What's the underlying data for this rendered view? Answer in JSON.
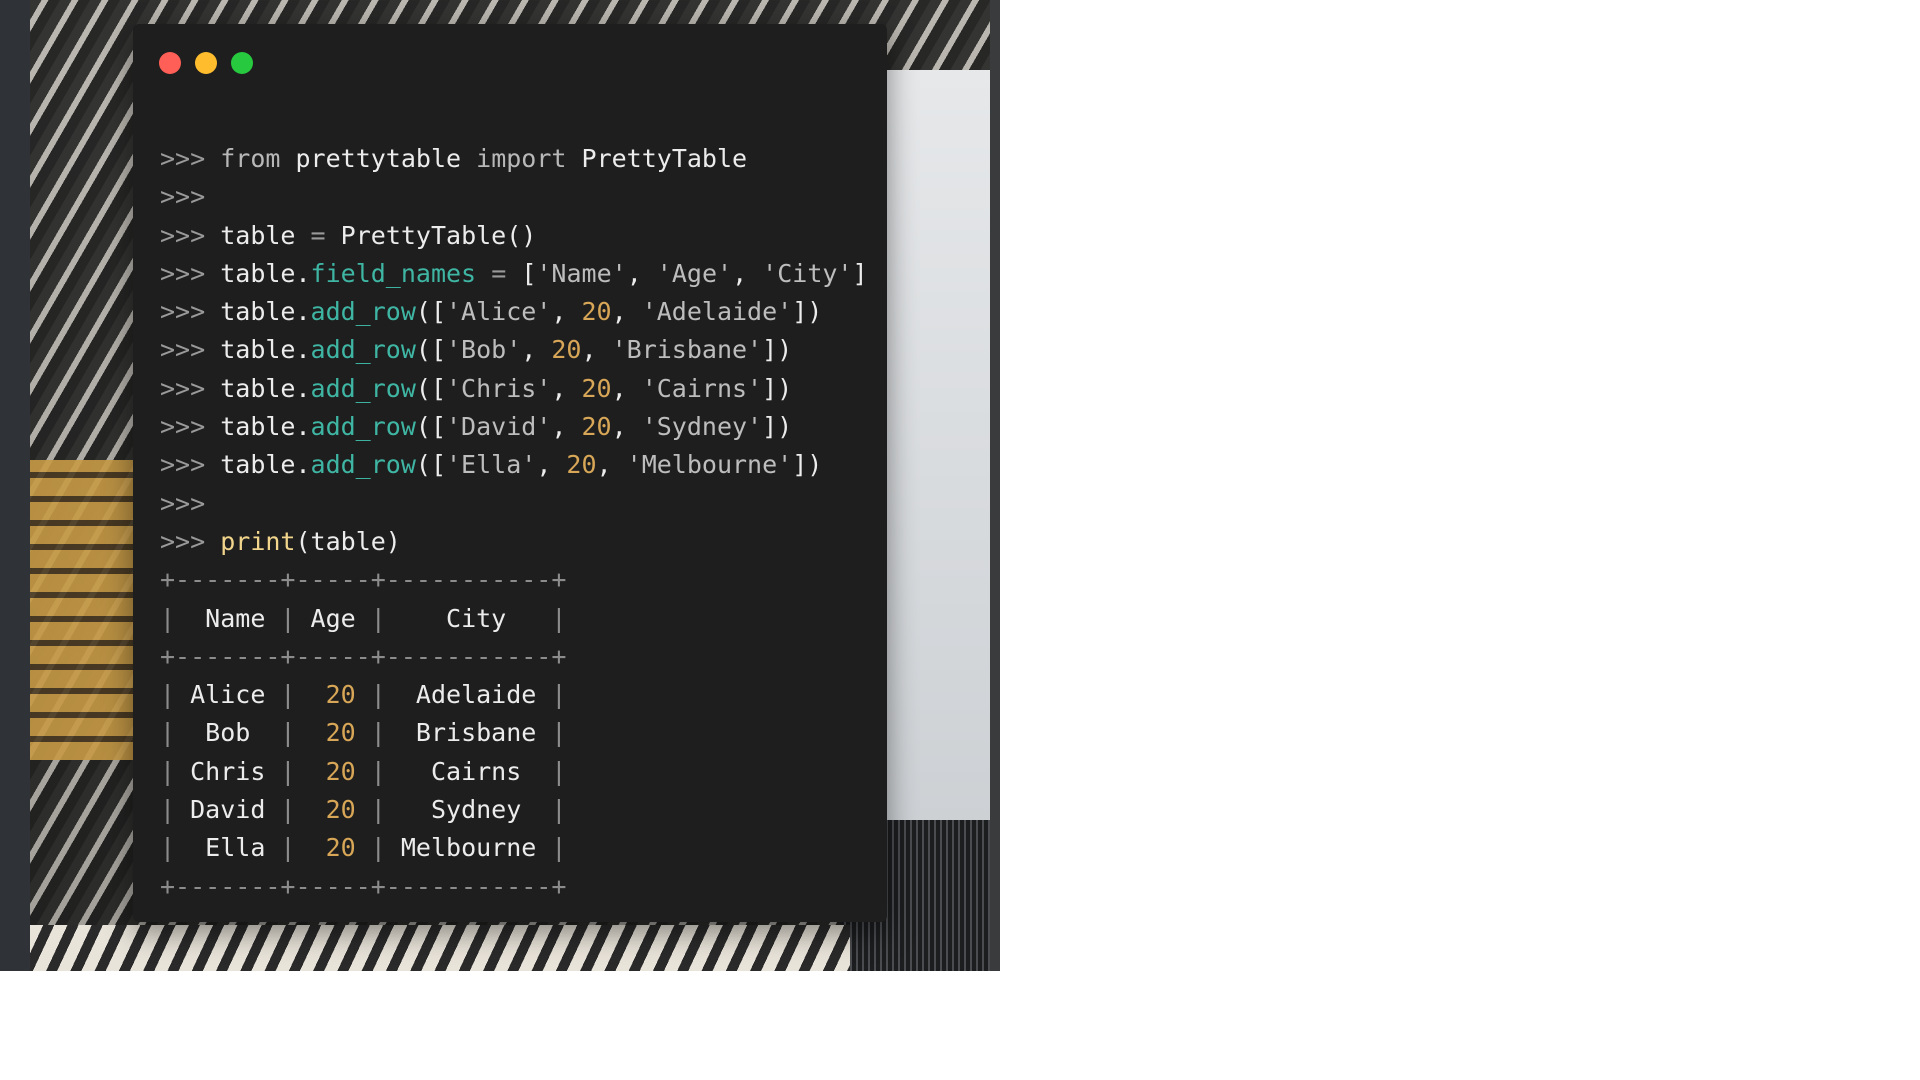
{
  "window": {
    "title": "",
    "controls": [
      "close",
      "minimize",
      "maximize"
    ]
  },
  "colors": {
    "close": "#ff5f56",
    "minimize": "#ffbd2e",
    "maximize": "#27c93f",
    "terminal_bg": "#1e1e1e",
    "attr": "#3fb6a4",
    "number": "#d7a657",
    "function": "#f2d58c"
  },
  "prompt": ">>>",
  "session": {
    "import_line": {
      "kw_from": "from",
      "module": "prettytable",
      "kw_import": "import",
      "name": "PrettyTable"
    },
    "create_line": {
      "var": "table",
      "op": "=",
      "call": "PrettyTable()"
    },
    "field_names_line": {
      "obj": "table",
      "attr": "field_names",
      "op": "=",
      "values": [
        "'Name'",
        "'Age'",
        "'City'"
      ]
    },
    "add_rows": [
      {
        "name": "'Alice'",
        "age": "20",
        "city": "'Adelaide'"
      },
      {
        "name": "'Bob'",
        "age": "20",
        "city": "'Brisbane'"
      },
      {
        "name": "'Chris'",
        "age": "20",
        "city": "'Cairns'"
      },
      {
        "name": "'David'",
        "age": "20",
        "city": "'Sydney'"
      },
      {
        "name": "'Ella'",
        "age": "20",
        "city": "'Melbourne'"
      }
    ],
    "add_row_method": "add_row",
    "print_line": {
      "fn": "print",
      "arg": "(table)"
    }
  },
  "output_table": {
    "border": "+-------+-----+-----------+",
    "header": {
      "name": "  Name ",
      "age": " Age ",
      "city": "    City   "
    },
    "rows": [
      {
        "name": " Alice ",
        "age": "  20 ",
        "city": "  Adelaide "
      },
      {
        "name": "  Bob  ",
        "age": "  20 ",
        "city": "  Brisbane "
      },
      {
        "name": " Chris ",
        "age": "  20 ",
        "city": "   Cairns  "
      },
      {
        "name": " David ",
        "age": "  20 ",
        "city": "   Sydney  "
      },
      {
        "name": "  Ella ",
        "age": "  20 ",
        "city": " Melbourne "
      }
    ]
  }
}
